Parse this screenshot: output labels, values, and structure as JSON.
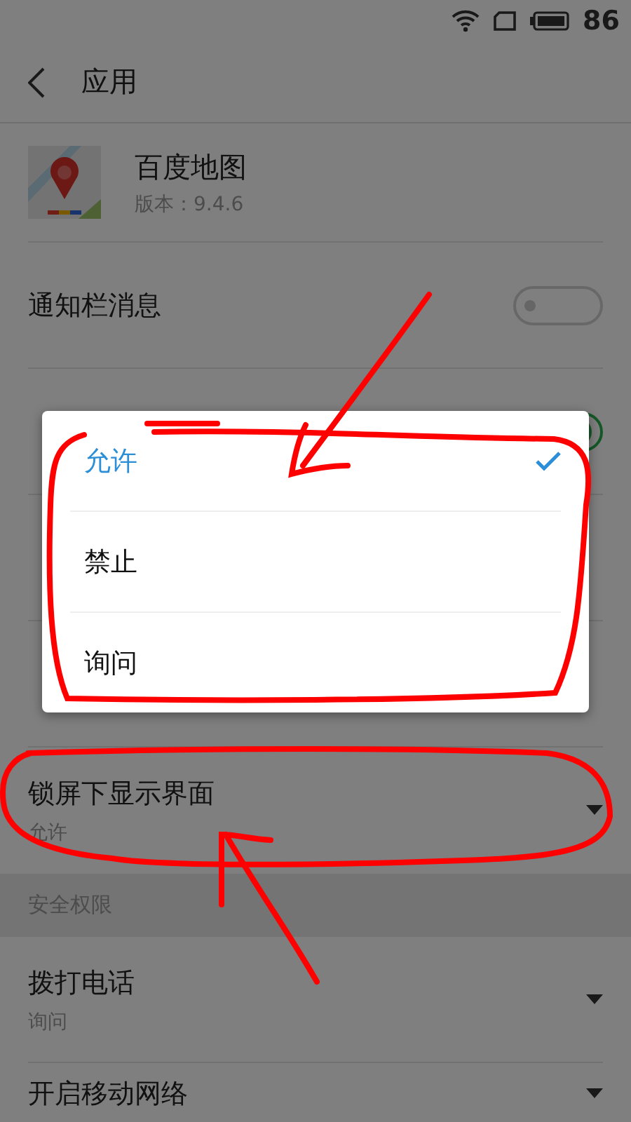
{
  "status_bar": {
    "battery": "86"
  },
  "header": {
    "title": "应用"
  },
  "app": {
    "name": "百度地图",
    "version": "版本：9.4.6"
  },
  "settings": [
    {
      "kind": "toggle",
      "title": "通知栏消息",
      "on": false
    },
    {
      "kind": "toggle",
      "on": true
    },
    {
      "kind": "choice"
    },
    {
      "kind": "choice"
    },
    {
      "kind": "choice",
      "title": "锁屏下显示界面",
      "value": "允许"
    },
    {
      "kind": "section",
      "title": "安全权限"
    },
    {
      "kind": "choice",
      "title": "拨打电话",
      "value": "询问"
    },
    {
      "kind": "choice",
      "title": "开启移动网络"
    }
  ],
  "popup": {
    "options": [
      {
        "label": "允许",
        "selected": true
      },
      {
        "label": "禁止",
        "selected": false
      },
      {
        "label": "询问",
        "selected": false
      }
    ]
  }
}
